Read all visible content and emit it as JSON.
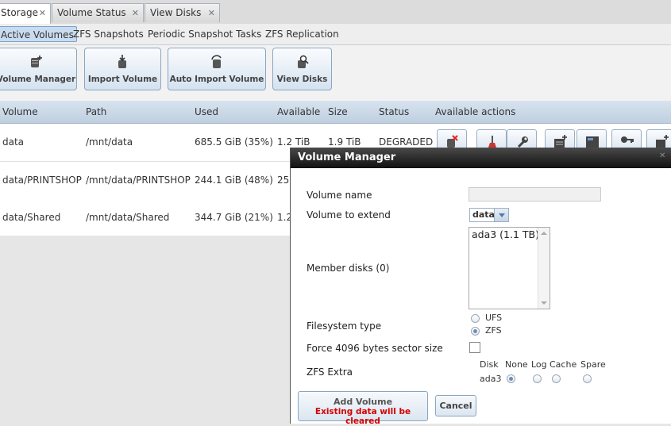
{
  "top_tabs": [
    {
      "label": "Storage",
      "active": true
    },
    {
      "label": "Volume Status",
      "active": false
    },
    {
      "label": "View Disks",
      "active": false
    }
  ],
  "sub_tabs": [
    {
      "label": "Active Volumes",
      "active": true
    },
    {
      "label": "ZFS Snapshots"
    },
    {
      "label": "Periodic Snapshot Tasks"
    },
    {
      "label": "ZFS Replication"
    }
  ],
  "toolbar": {
    "volume_manager": "Volume Manager",
    "import_volume": "Import Volume",
    "auto_import_volume": "Auto Import Volume",
    "view_disks": "View Disks"
  },
  "grid": {
    "headers": [
      "Volume",
      "Path",
      "Used",
      "Available",
      "Size",
      "Status",
      "Available actions"
    ],
    "rows": [
      {
        "volume": "data",
        "path": "/mnt/data",
        "used": "685.5 GiB (35%)",
        "available": "1.2 TiB",
        "size": "1.9 TiB",
        "status": "DEGRADED"
      },
      {
        "volume": "data/PRINTSHOP",
        "path": "/mnt/data/PRINTSHOP",
        "used": "244.1 GiB (48%)",
        "available": "25",
        "size": "",
        "status": ""
      },
      {
        "volume": "data/Shared",
        "path": "/mnt/data/Shared",
        "used": "344.7 GiB (21%)",
        "available": "1.2",
        "size": "",
        "status": ""
      }
    ]
  },
  "dialog": {
    "title": "Volume Manager",
    "labels": {
      "volume_name": "Volume name",
      "volume_to_extend": "Volume to extend",
      "member_disks": "Member disks (0)",
      "filesystem_type": "Filesystem type",
      "force_4096": "Force 4096 bytes sector size",
      "zfs_extra": "ZFS Extra"
    },
    "volume_name_value": "",
    "volume_to_extend_value": "data",
    "member_disk_options": [
      "ada3 (1.1 TB)"
    ],
    "filesystem_options": [
      {
        "label": "UFS",
        "selected": false
      },
      {
        "label": "ZFS",
        "selected": true
      }
    ],
    "zfs_extra": {
      "headers": [
        "Disk",
        "None",
        "Log",
        "Cache",
        "Spare"
      ],
      "disk": "ada3",
      "selected": "None"
    },
    "add_button": {
      "line1": "Add Volume",
      "line2": "Existing data will be cleared"
    },
    "cancel_button": "Cancel"
  },
  "colors": {
    "warning_text": "#d40000",
    "dialog_title_bg": "#1a1a1a",
    "grid_header_bg": "#c9d8e8"
  }
}
